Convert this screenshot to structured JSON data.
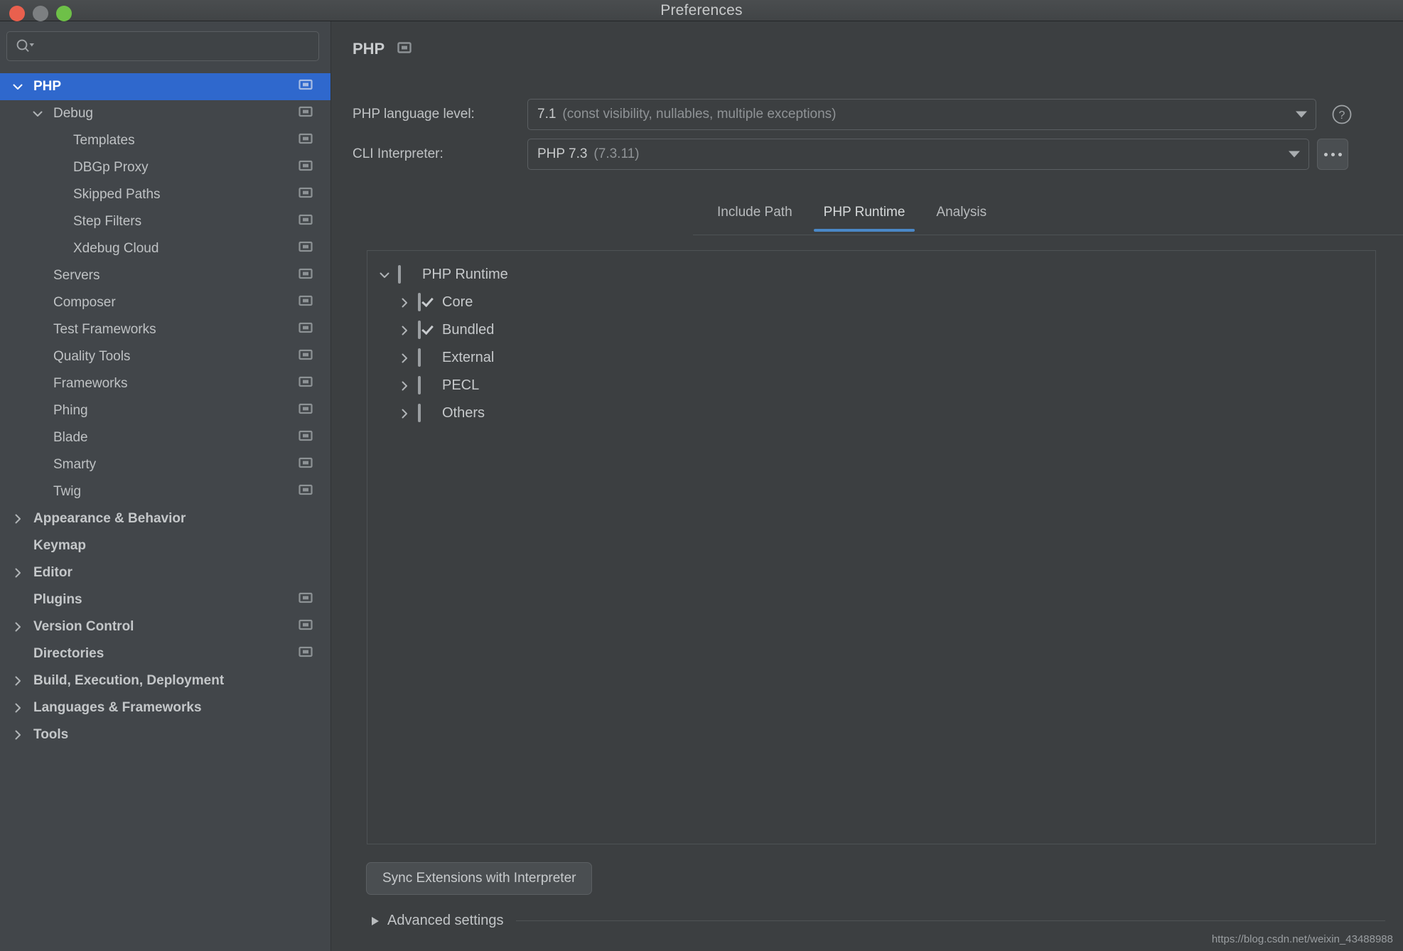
{
  "window": {
    "title": "Preferences",
    "controls": {
      "close": "close-button",
      "minimize": "minimize-button",
      "maximize": "maximize-button"
    }
  },
  "sidebar": {
    "search": {
      "placeholder": "",
      "value": "",
      "icon": "search-icon"
    },
    "items": [
      {
        "label": "PHP",
        "level": 0,
        "arrow": "down",
        "bold": true,
        "selected": true,
        "config_icon": true
      },
      {
        "label": "Debug",
        "level": 1,
        "arrow": "down",
        "bold": false,
        "selected": false,
        "config_icon": true
      },
      {
        "label": "Templates",
        "level": 2,
        "arrow": "none",
        "bold": false,
        "selected": false,
        "config_icon": true
      },
      {
        "label": "DBGp Proxy",
        "level": 2,
        "arrow": "none",
        "bold": false,
        "selected": false,
        "config_icon": true
      },
      {
        "label": "Skipped Paths",
        "level": 2,
        "arrow": "none",
        "bold": false,
        "selected": false,
        "config_icon": true
      },
      {
        "label": "Step Filters",
        "level": 2,
        "arrow": "none",
        "bold": false,
        "selected": false,
        "config_icon": true
      },
      {
        "label": "Xdebug Cloud",
        "level": 2,
        "arrow": "none",
        "bold": false,
        "selected": false,
        "config_icon": true
      },
      {
        "label": "Servers",
        "level": 1,
        "arrow": "none",
        "bold": false,
        "selected": false,
        "config_icon": true
      },
      {
        "label": "Composer",
        "level": 1,
        "arrow": "none",
        "bold": false,
        "selected": false,
        "config_icon": true
      },
      {
        "label": "Test Frameworks",
        "level": 1,
        "arrow": "none",
        "bold": false,
        "selected": false,
        "config_icon": true
      },
      {
        "label": "Quality Tools",
        "level": 1,
        "arrow": "none",
        "bold": false,
        "selected": false,
        "config_icon": true
      },
      {
        "label": "Frameworks",
        "level": 1,
        "arrow": "none",
        "bold": false,
        "selected": false,
        "config_icon": true
      },
      {
        "label": "Phing",
        "level": 1,
        "arrow": "none",
        "bold": false,
        "selected": false,
        "config_icon": true
      },
      {
        "label": "Blade",
        "level": 1,
        "arrow": "none",
        "bold": false,
        "selected": false,
        "config_icon": true
      },
      {
        "label": "Smarty",
        "level": 1,
        "arrow": "none",
        "bold": false,
        "selected": false,
        "config_icon": true
      },
      {
        "label": "Twig",
        "level": 1,
        "arrow": "none",
        "bold": false,
        "selected": false,
        "config_icon": true
      },
      {
        "label": "Appearance & Behavior",
        "level": 0,
        "arrow": "right",
        "bold": true,
        "selected": false,
        "config_icon": false
      },
      {
        "label": "Keymap",
        "level": 0,
        "arrow": "none",
        "bold": true,
        "selected": false,
        "config_icon": false
      },
      {
        "label": "Editor",
        "level": 0,
        "arrow": "right",
        "bold": true,
        "selected": false,
        "config_icon": false
      },
      {
        "label": "Plugins",
        "level": 0,
        "arrow": "none",
        "bold": true,
        "selected": false,
        "config_icon": true
      },
      {
        "label": "Version Control",
        "level": 0,
        "arrow": "right",
        "bold": true,
        "selected": false,
        "config_icon": true
      },
      {
        "label": "Directories",
        "level": 0,
        "arrow": "none",
        "bold": true,
        "selected": false,
        "config_icon": true
      },
      {
        "label": "Build, Execution, Deployment",
        "level": 0,
        "arrow": "right",
        "bold": true,
        "selected": false,
        "config_icon": false
      },
      {
        "label": "Languages & Frameworks",
        "level": 0,
        "arrow": "right",
        "bold": true,
        "selected": false,
        "config_icon": false
      },
      {
        "label": "Tools",
        "level": 0,
        "arrow": "right",
        "bold": true,
        "selected": false,
        "config_icon": false
      }
    ]
  },
  "main": {
    "page_title": "PHP",
    "language_level": {
      "label": "PHP language level:",
      "value": "7.1",
      "value_detail": "(const visibility, nullables, multiple exceptions)",
      "help_icon": "help-icon"
    },
    "cli_interpreter": {
      "label": "CLI Interpreter:",
      "value": "PHP 7.3",
      "value_detail": "(7.3.11)",
      "browse_label": "..."
    },
    "tabs": [
      {
        "label": "Include Path",
        "active": false
      },
      {
        "label": "PHP Runtime",
        "active": true
      },
      {
        "label": "Analysis",
        "active": false
      }
    ],
    "runtime_tree": [
      {
        "label": "PHP Runtime",
        "level": 0,
        "arrow": "down",
        "check": "partial"
      },
      {
        "label": "Core",
        "level": 1,
        "arrow": "right",
        "check": "checked"
      },
      {
        "label": "Bundled",
        "level": 1,
        "arrow": "right",
        "check": "checked"
      },
      {
        "label": "External",
        "level": 1,
        "arrow": "right",
        "check": "partial"
      },
      {
        "label": "PECL",
        "level": 1,
        "arrow": "right",
        "check": "partial"
      },
      {
        "label": "Others",
        "level": 1,
        "arrow": "right",
        "check": "partial"
      }
    ],
    "sync_button": "Sync Extensions with Interpreter",
    "advanced_settings": "Advanced settings"
  },
  "watermark": "https://blog.csdn.net/weixin_43488988",
  "colors": {
    "accent_selection": "#2f68cd",
    "accent_tab_underline": "#4a88c7",
    "window_bg": "#3c3f41",
    "sidebar_bg": "#42464a",
    "text": "#c8cacb",
    "text_muted": "#8f9396",
    "close_button": "#e9604e",
    "minimize_button": "#7c7f81",
    "maximize_button": "#6ec048"
  }
}
